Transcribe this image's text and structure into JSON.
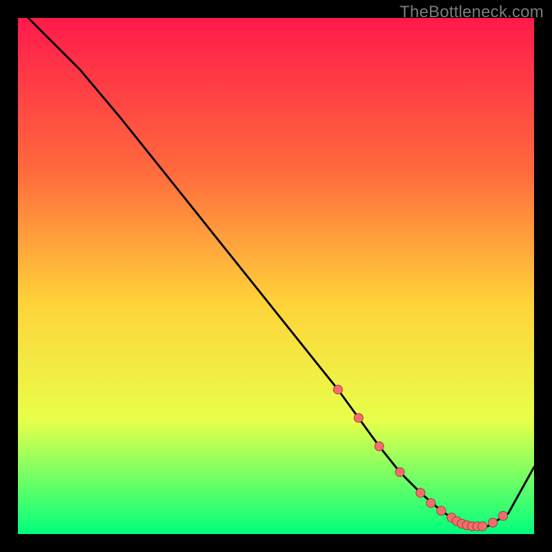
{
  "watermark": "TheBottleneck.com",
  "colors": {
    "gradient_top": "#ff1a4b",
    "gradient_mid_upper": "#ff6b3d",
    "gradient_mid": "#ffd23a",
    "gradient_mid_lower": "#e8ff4a",
    "gradient_bottom": "#00ff7e",
    "curve": "#000000",
    "dot_fill": "#f26d6d",
    "dot_stroke": "#a83a3a",
    "frame_bg": "#000000"
  },
  "chart_data": {
    "type": "line",
    "title": "",
    "xlabel": "",
    "ylabel": "",
    "xlim": [
      0,
      100
    ],
    "ylim": [
      0,
      100
    ],
    "grid": false,
    "legend": false,
    "series": [
      {
        "name": "curve",
        "x": [
          2,
          6,
          12,
          20,
          30,
          40,
          50,
          58,
          62,
          66,
          70,
          74,
          78,
          82,
          85,
          88,
          91,
          95,
          100
        ],
        "y": [
          100,
          96,
          90,
          80.5,
          68,
          55.5,
          43,
          33,
          28,
          22.5,
          17,
          12,
          8,
          4.5,
          2.5,
          1.5,
          1.5,
          4,
          13
        ]
      }
    ],
    "annotations_dots": [
      {
        "x": 62,
        "y": 28
      },
      {
        "x": 66,
        "y": 22.5
      },
      {
        "x": 70,
        "y": 17
      },
      {
        "x": 74,
        "y": 12
      },
      {
        "x": 78,
        "y": 8
      },
      {
        "x": 80,
        "y": 6
      },
      {
        "x": 82,
        "y": 4.5
      },
      {
        "x": 84,
        "y": 3.2
      },
      {
        "x": 85,
        "y": 2.5
      },
      {
        "x": 86,
        "y": 2.0
      },
      {
        "x": 87,
        "y": 1.7
      },
      {
        "x": 88,
        "y": 1.5
      },
      {
        "x": 89,
        "y": 1.5
      },
      {
        "x": 90,
        "y": 1.5
      },
      {
        "x": 92,
        "y": 2.2
      },
      {
        "x": 94,
        "y": 3.5
      }
    ]
  }
}
